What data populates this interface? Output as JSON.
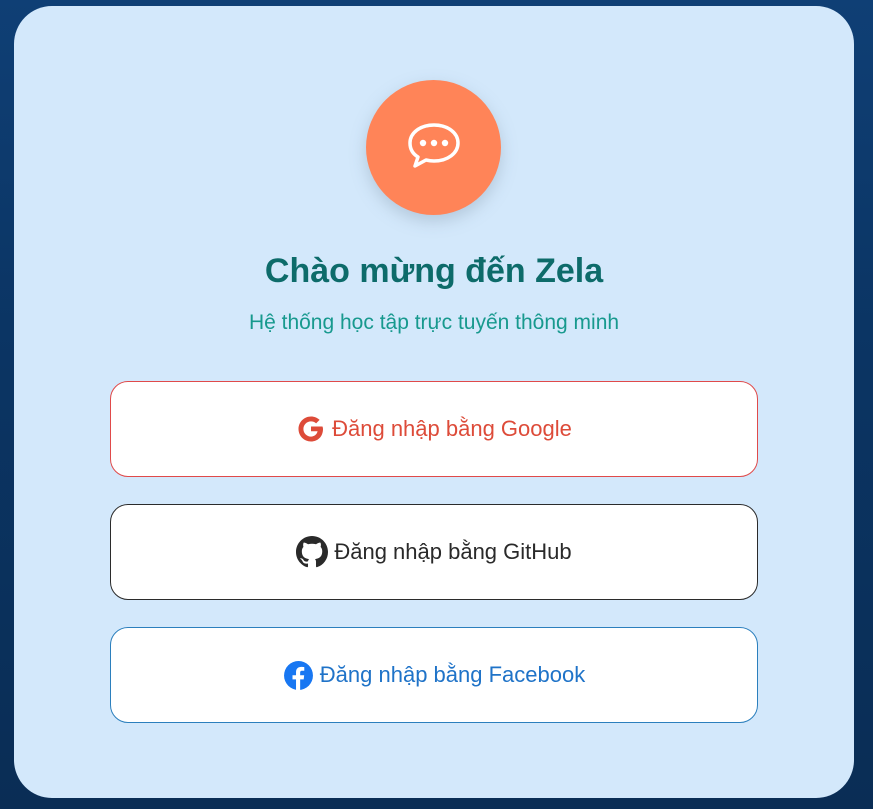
{
  "app": {
    "title": "Chào mừng đến Zela",
    "subtitle": "Hệ thống học tập trực tuyến thông minh",
    "logo_icon": "chat-bubble-icon"
  },
  "login": {
    "google_label": "Đăng nhập bằng Google",
    "github_label": "Đăng nhập bằng GitHub",
    "facebook_label": "Đăng nhập bằng Facebook"
  },
  "colors": {
    "accent": "#ff8458",
    "title": "#0d6b6a",
    "subtitle": "#17998e",
    "google": "#dd4b39",
    "github": "#2a2a2a",
    "facebook": "#1f73c8",
    "card_bg": "#d3e8fb",
    "page_bg": "#0b3564"
  }
}
